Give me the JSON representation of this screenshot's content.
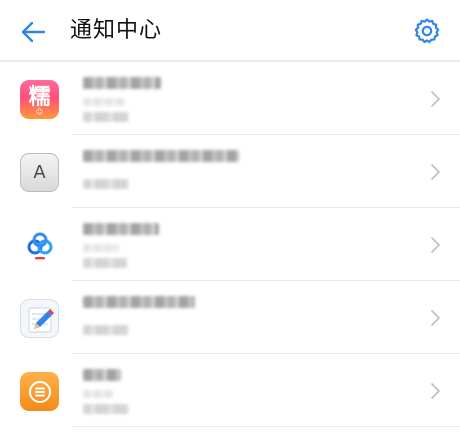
{
  "header": {
    "title": "通知中心",
    "back_icon": "arrow-left-icon",
    "settings_icon": "gear-icon",
    "accent_color": "#2f86e8"
  },
  "apps": [
    {
      "icon": "nuo-app-icon",
      "icon_glyph": "糯",
      "icon_sub": "☺"
    },
    {
      "icon": "dictionary-app-icon",
      "icon_glyph": "A"
    },
    {
      "icon": "baidu-netdisk-icon"
    },
    {
      "icon": "notes-app-icon"
    },
    {
      "icon": "recorder-app-icon"
    }
  ],
  "colors": {
    "divider": "#e8e8e8",
    "chevron": "#c2c2c2",
    "title_text": "#111111"
  }
}
